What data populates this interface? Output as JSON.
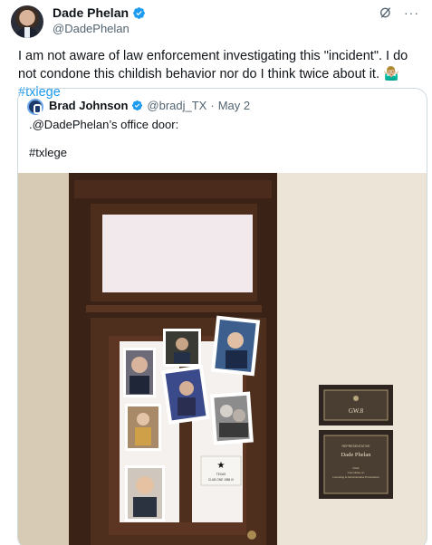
{
  "post": {
    "author_name": "Dade Phelan",
    "author_handle": "@DadePhelan",
    "text_main": "I am not aware of law enforcement investigating this \"incident\". I do not condone this childish behavior nor do I think twice about it. 🤷🏼‍♂️ ",
    "hashtag": "#txlege",
    "more_label": "···"
  },
  "quote": {
    "author_name": "Brad Johnson",
    "author_handle": "@bradj_TX",
    "dot": "·",
    "date": "May 2",
    "line1": ".@DadePhelan’s office door:",
    "line2": "#txlege"
  },
  "photo": {
    "plaque1": "GW.8",
    "plaque2_title": "REPRESENTATIVE",
    "plaque2_name": "Dade Phelan",
    "plaque2_sub1": "Chair",
    "plaque2_sub2": "Committee on",
    "plaque2_sub3": "Licensing & Administrative Procedures",
    "card_small": "TEXAS",
    "card_line": "CLUB ONE 1988 IV"
  },
  "colors": {
    "brand_blue": "#1d9bf0",
    "text_secondary": "#536471",
    "border": "#cfd9de"
  }
}
